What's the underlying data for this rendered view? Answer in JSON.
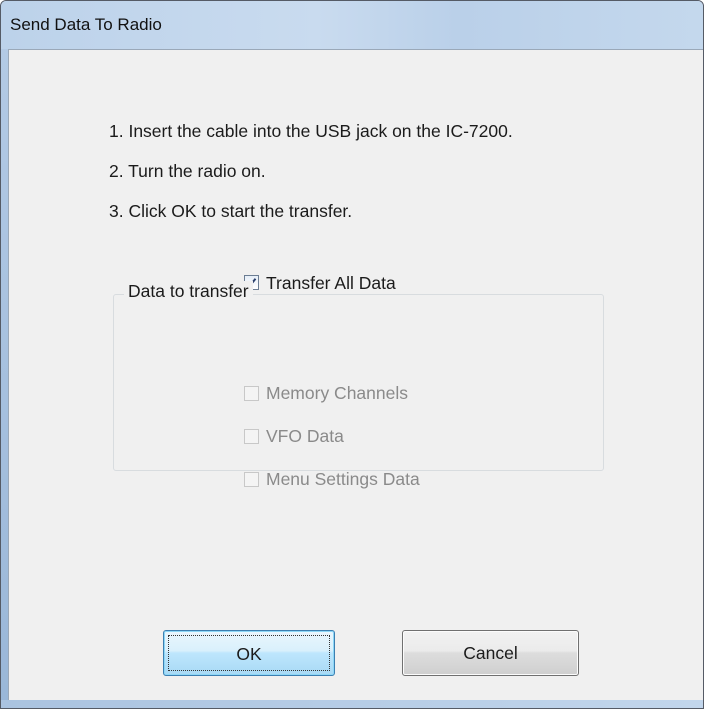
{
  "window": {
    "title": "Send Data To Radio"
  },
  "instructions": [
    "1. Insert the cable into the USB jack on the IC-7200.",
    "2. Turn the radio on.",
    "3. Click OK to start the transfer."
  ],
  "transfer_all": {
    "label": "Transfer All Data",
    "checked": true
  },
  "group": {
    "legend": "Data to transfer",
    "options": [
      {
        "label": "Memory Channels",
        "checked": false,
        "enabled": false
      },
      {
        "label": "VFO Data",
        "checked": false,
        "enabled": false
      },
      {
        "label": "Menu Settings Data",
        "checked": false,
        "enabled": false
      }
    ]
  },
  "buttons": {
    "ok_label": "OK",
    "cancel_label": "Cancel"
  },
  "colors": {
    "accent": "#3c7fb1",
    "disabled_text": "#8a8a8a"
  }
}
